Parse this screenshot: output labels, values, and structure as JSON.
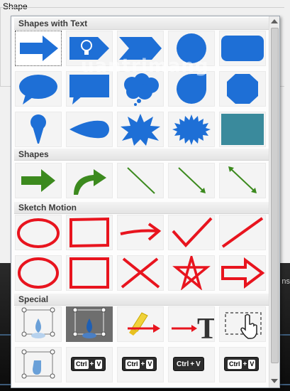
{
  "panel": {
    "shape_label": "Shape"
  },
  "popup": {
    "categories": [
      {
        "name": "Shapes with Text"
      },
      {
        "name": "Shapes"
      },
      {
        "name": "Sketch Motion"
      },
      {
        "name": "Special"
      }
    ],
    "special_keys": {
      "ctrl": "Ctrl",
      "plus": "+",
      "v": "V"
    }
  },
  "watermark": "uantrimang",
  "right_edge_text": "ns",
  "colors": {
    "shape_blue": "#1e6fd6",
    "shape_teal": "#3a8a9c",
    "shape_green": "#3c8a1e",
    "sketch_red": "#e8141e",
    "header_bg": "#e8e8e8"
  }
}
